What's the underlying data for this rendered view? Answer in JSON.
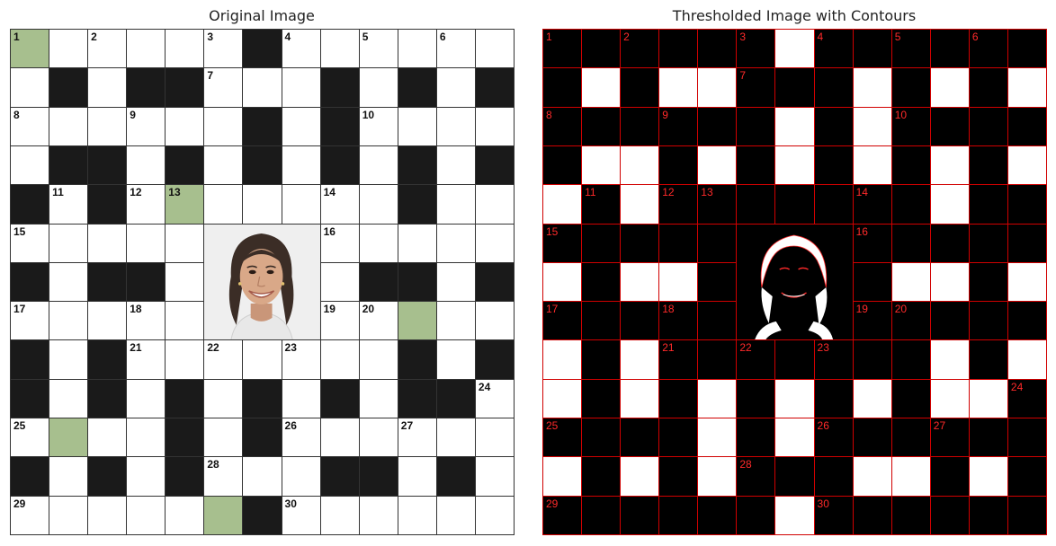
{
  "titles": {
    "left": "Original Image",
    "right": "Thresholded Image with Contours"
  },
  "colors": {
    "black_cell": "#1a1a1a",
    "white_cell": "#ffffff",
    "highlight_cell": "#a7bf8e",
    "contour": "#d10000",
    "contour_number": "#ff2a2a"
  },
  "grid": {
    "rows": 13,
    "cols": 13,
    "photo_region": {
      "row_start": 5,
      "row_end": 7,
      "col_start": 5,
      "col_end": 7
    },
    "cells": [
      "HW.WW.BW.WW.W",
      "WBWBBWWWBWBWB",
      "WWWWWWBWBWWWW",
      "WBBWBWBWBWBWB",
      "BWBWHWWWWWBWW",
      "WWWWWPPPWWWWW",
      "BWBBWPPPWBBWB",
      "WWWWWPPPWWHWW",
      "BWBWWWWWWWBWB",
      "BWBWBWBWBWBBW",
      "WHWWBWBWWWWWW",
      "BWBWBWWWBBWBW",
      "WWWWWHBWWWWWW"
    ],
    "numbers": [
      {
        "r": 0,
        "c": 0,
        "n": "1"
      },
      {
        "r": 0,
        "c": 2,
        "n": "2"
      },
      {
        "r": 0,
        "c": 5,
        "n": "3"
      },
      {
        "r": 0,
        "c": 7,
        "n": "4"
      },
      {
        "r": 0,
        "c": 9,
        "n": "5"
      },
      {
        "r": 0,
        "c": 11,
        "n": "6"
      },
      {
        "r": 1,
        "c": 5,
        "n": "7"
      },
      {
        "r": 2,
        "c": 0,
        "n": "8"
      },
      {
        "r": 2,
        "c": 3,
        "n": "9"
      },
      {
        "r": 2,
        "c": 9,
        "n": "10"
      },
      {
        "r": 4,
        "c": 1,
        "n": "11"
      },
      {
        "r": 4,
        "c": 3,
        "n": "12"
      },
      {
        "r": 4,
        "c": 4,
        "n": "13"
      },
      {
        "r": 4,
        "c": 8,
        "n": "14"
      },
      {
        "r": 5,
        "c": 0,
        "n": "15"
      },
      {
        "r": 5,
        "c": 8,
        "n": "16"
      },
      {
        "r": 7,
        "c": 0,
        "n": "17"
      },
      {
        "r": 7,
        "c": 3,
        "n": "18"
      },
      {
        "r": 7,
        "c": 8,
        "n": "19"
      },
      {
        "r": 7,
        "c": 9,
        "n": "20"
      },
      {
        "r": 8,
        "c": 3,
        "n": "21"
      },
      {
        "r": 8,
        "c": 5,
        "n": "22"
      },
      {
        "r": 8,
        "c": 7,
        "n": "23"
      },
      {
        "r": 9,
        "c": 12,
        "n": "24"
      },
      {
        "r": 10,
        "c": 0,
        "n": "25"
      },
      {
        "r": 10,
        "c": 7,
        "n": "26"
      },
      {
        "r": 10,
        "c": 10,
        "n": "27"
      },
      {
        "r": 11,
        "c": 5,
        "n": "28"
      },
      {
        "r": 12,
        "c": 0,
        "n": "29"
      },
      {
        "r": 12,
        "c": 7,
        "n": "30"
      }
    ]
  }
}
